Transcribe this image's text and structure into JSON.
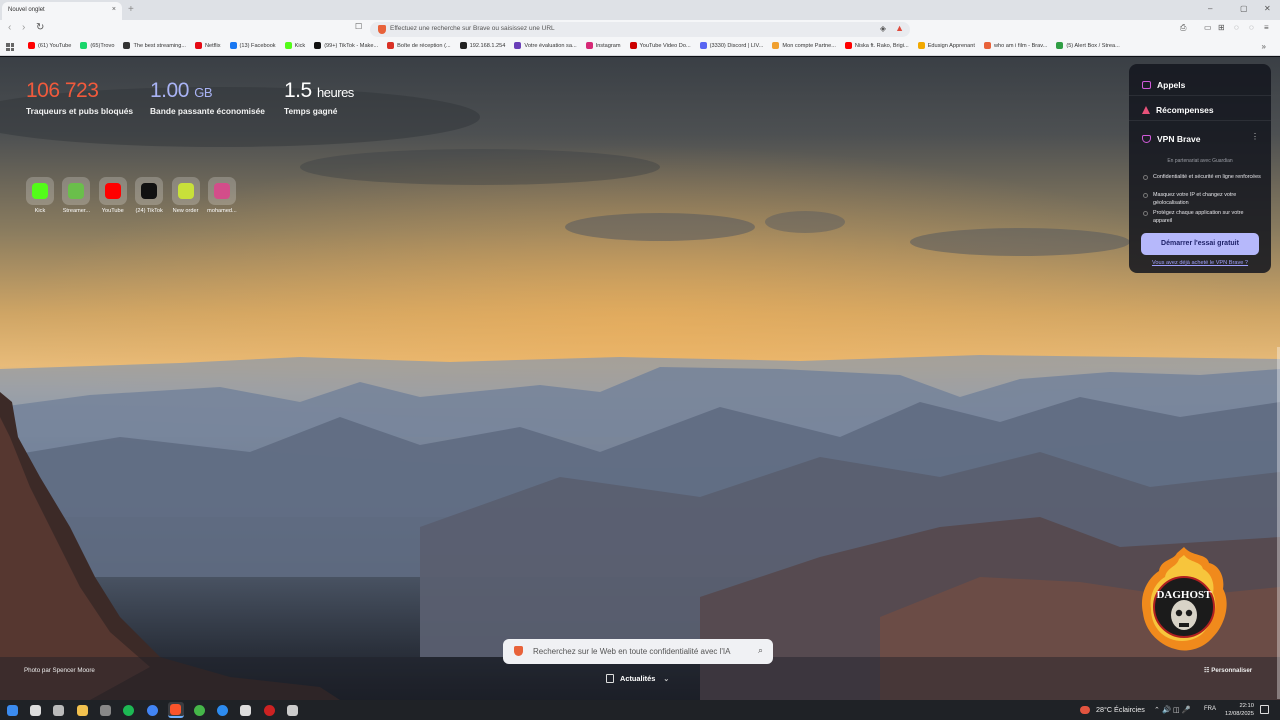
{
  "tab": {
    "title": "Nouvel onglet",
    "close_glyph": "×",
    "new_tab_glyph": "+"
  },
  "window_controls": {
    "minimize": "–",
    "maximize": "▢",
    "close": "✕"
  },
  "toolbar": {
    "back_glyph": "‹",
    "forward_glyph": "›",
    "reload_glyph": "↻",
    "bookmark_glyph": "☐",
    "url_placeholder": "Effectuez une recherche sur Brave ou saisissez une URL",
    "shield_glyph": "◈",
    "rewards_glyph": "▲",
    "right_glyphs": [
      "⎙",
      "▭",
      "⊞",
      "◌",
      "≡"
    ]
  },
  "bookmarks": [
    {
      "label": "(61) YouTube",
      "color": "#ff0000"
    },
    {
      "label": "(65)Trovo",
      "color": "#19d66b"
    },
    {
      "label": "The best streaming...",
      "color": "#333333"
    },
    {
      "label": "Netflix",
      "color": "#e50914"
    },
    {
      "label": "(13) Facebook",
      "color": "#1877f2"
    },
    {
      "label": "Kick",
      "color": "#53fc18"
    },
    {
      "label": "(99+) TikTok - Make...",
      "color": "#111111"
    },
    {
      "label": "Boîte de réception (...",
      "color": "#d93025"
    },
    {
      "label": "192.168.1.254",
      "color": "#222222"
    },
    {
      "label": "Votre évaluation sa...",
      "color": "#6a3fb8"
    },
    {
      "label": "Instagram",
      "color": "#d62976"
    },
    {
      "label": "YouTube Video Do...",
      "color": "#cc0000"
    },
    {
      "label": "(3330) Discord | LIV...",
      "color": "#5865f2"
    },
    {
      "label": "Mon compte Partne...",
      "color": "#f0a030"
    },
    {
      "label": "Niska ft. Rako, Brigi...",
      "color": "#ff0000"
    },
    {
      "label": "Edusign Apprenant",
      "color": "#f2a900"
    },
    {
      "label": "who am i film - Brav...",
      "color": "#e8623a"
    },
    {
      "label": "(5) Alert Box / Strea...",
      "color": "#2f9e44"
    }
  ],
  "bookmarks_more": "»",
  "stats": [
    {
      "value": "106 723",
      "unit": "",
      "label": "Traqueurs et pubs bloqués",
      "color": "#f15a3c"
    },
    {
      "value": "1.00",
      "unit": "GB",
      "label": "Bande passante économisée",
      "color": "#a9b3f5"
    },
    {
      "value": "1.5",
      "unit": "heures",
      "label": "Temps gagné",
      "color": "#ffffff"
    }
  ],
  "top_sites": [
    {
      "label": "Kick",
      "logo_color": "#53fc18"
    },
    {
      "label": "Streamer...",
      "logo_color": "#6abf4b"
    },
    {
      "label": "YouTube",
      "logo_color": "#ff0000"
    },
    {
      "label": "(24) TikTok",
      "logo_color": "#111111"
    },
    {
      "label": "New order",
      "logo_color": "#c8e03a"
    },
    {
      "label": "mohamed...",
      "logo_color": "#d34d8a"
    }
  ],
  "panel": {
    "calls": "Appels",
    "rewards": "Récompenses",
    "vpn_title": "VPN Brave",
    "kebab": "⋮",
    "partner": "En partenariat avec Guardian",
    "features": [
      "Confidentialité et sécurité en ligne renforcées",
      "Masquez votre IP et changez votre géolocalisation",
      "Protégez chaque application sur votre appareil"
    ],
    "trial_button": "Démarrer l'essai gratuit",
    "already_bought": "Vous avez déjà acheté le VPN Brave ?"
  },
  "badge": {
    "text": "DAGHOST"
  },
  "photo_credit": "Photo par Spencer Moore",
  "customize": "Personnaliser",
  "search": {
    "placeholder": "Recherchez sur le Web en toute confidentialité avec l'IA",
    "mag_glyph": "⌕"
  },
  "news": {
    "label": "Actualités",
    "chevron": "⌄"
  },
  "taskbar": {
    "icons": [
      {
        "name": "start",
        "color": "#3b8cf0"
      },
      {
        "name": "search",
        "color": "#dddddd"
      },
      {
        "name": "taskview",
        "color": "#bbbbbb"
      },
      {
        "name": "files",
        "color": "#f2c14e"
      },
      {
        "name": "photos",
        "color": "#888888"
      },
      {
        "name": "spotify",
        "color": "#1db954"
      },
      {
        "name": "chrome",
        "color": "#4285f4"
      },
      {
        "name": "brave",
        "color": "#fb542b"
      },
      {
        "name": "xbox",
        "color": "#45b649"
      },
      {
        "name": "edge",
        "color": "#2d8cf0"
      },
      {
        "name": "capcut",
        "color": "#dddddd"
      },
      {
        "name": "obs",
        "color": "#cc2222"
      },
      {
        "name": "app",
        "color": "#cccccc"
      }
    ],
    "weather": "28°C Éclaircies",
    "tray": "⌃ 🔊 ◫ 🎤",
    "lang": "FRA",
    "time": "22:10",
    "date": "12/08/2025"
  }
}
